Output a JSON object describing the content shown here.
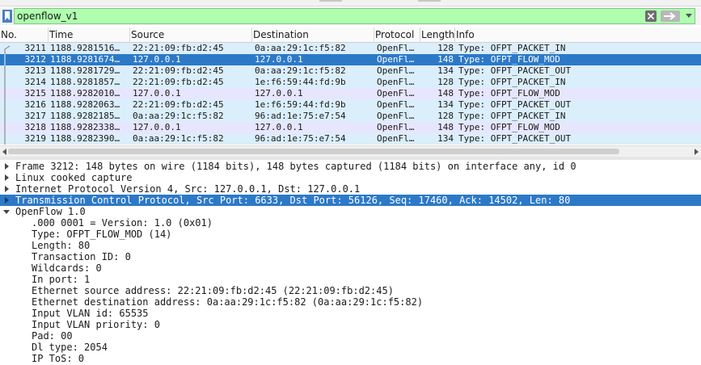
{
  "filter": {
    "value": "openflow_v1"
  },
  "columns": {
    "no": "No.",
    "time": "Time",
    "source": "Source",
    "destination": "Destination",
    "protocol": "Protocol",
    "length": "Length",
    "info": "Info"
  },
  "packets": [
    {
      "no": "3211",
      "time": "1188.9281516…",
      "source": "22:21:09:fb:d2:45",
      "destination": "0a:aa:29:1c:f5:82",
      "protocol": "OpenFl…",
      "length": "128",
      "info": "Type: OFPT_PACKET_IN"
    },
    {
      "no": "3212",
      "time": "1188.9281674…",
      "source": "127.0.0.1",
      "destination": "127.0.0.1",
      "protocol": "OpenFl…",
      "length": "148",
      "info": "Type: OFPT_FLOW_MOD"
    },
    {
      "no": "3213",
      "time": "1188.9281729…",
      "source": "22:21:09:fb:d2:45",
      "destination": "0a:aa:29:1c:f5:82",
      "protocol": "OpenFl…",
      "length": "134",
      "info": "Type: OFPT_PACKET_OUT"
    },
    {
      "no": "3214",
      "time": "1188.9281857…",
      "source": "22:21:09:fb:d2:45",
      "destination": "1e:f6:59:44:fd:9b",
      "protocol": "OpenFl…",
      "length": "128",
      "info": "Type: OFPT_PACKET_IN"
    },
    {
      "no": "3215",
      "time": "1188.9282010…",
      "source": "127.0.0.1",
      "destination": "127.0.0.1",
      "protocol": "OpenFl…",
      "length": "148",
      "info": "Type: OFPT_FLOW_MOD"
    },
    {
      "no": "3216",
      "time": "1188.9282063…",
      "source": "22:21:09:fb:d2:45",
      "destination": "1e:f6:59:44:fd:9b",
      "protocol": "OpenFl…",
      "length": "134",
      "info": "Type: OFPT_PACKET_OUT"
    },
    {
      "no": "3217",
      "time": "1188.9282185…",
      "source": "0a:aa:29:1c:f5:82",
      "destination": "96:ad:1e:75:e7:54",
      "protocol": "OpenFl…",
      "length": "128",
      "info": "Type: OFPT_PACKET_IN"
    },
    {
      "no": "3218",
      "time": "1188.9282338…",
      "source": "127.0.0.1",
      "destination": "127.0.0.1",
      "protocol": "OpenFl…",
      "length": "148",
      "info": "Type: OFPT_FLOW_MOD"
    },
    {
      "no": "3219",
      "time": "1188.9282390…",
      "source": "0a:aa:29:1c:f5:82",
      "destination": "96:ad:1e:75:e7:54",
      "protocol": "OpenFl…",
      "length": "134",
      "info": "Type: OFPT_PACKET_OUT"
    }
  ],
  "details": {
    "frame": "Frame 3212: 148 bytes on wire (1184 bits), 148 bytes captured (1184 bits) on interface any, id 0",
    "sll": "Linux cooked capture",
    "ip": "Internet Protocol Version 4, Src: 127.0.0.1, Dst: 127.0.0.1",
    "tcp": "Transmission Control Protocol, Src Port: 6633, Dst Port: 56126, Seq: 17460, Ack: 14502, Len: 80",
    "openflow": "OpenFlow 1.0",
    "fields": [
      ".000 0001 = Version: 1.0 (0x01)",
      "Type: OFPT_FLOW_MOD (14)",
      "Length: 80",
      "Transaction ID: 0",
      "Wildcards: 0",
      "In port: 1",
      "Ethernet source address: 22:21:09:fb:d2:45 (22:21:09:fb:d2:45)",
      "Ethernet destination address: 0a:aa:29:1c:f5:82 (0a:aa:29:1c:f5:82)",
      "Input VLAN id: 65535",
      "Input VLAN priority: 0",
      "Pad: 00",
      "Dl type: 2054",
      "IP ToS: 0"
    ]
  },
  "colors": {
    "filter_valid": "#afffaf",
    "selected": "#2c79c8",
    "tcp_row": "#e7e6ff",
    "openflow_row": "#dbeefb"
  },
  "icons": {
    "bookmark": "bookmark-icon",
    "clear": "clear-icon",
    "apply": "arrow-right-icon",
    "dropdown": "chevron-down-icon",
    "expanded": "triangle-down-icon",
    "collapsed": "triangle-right-icon"
  }
}
